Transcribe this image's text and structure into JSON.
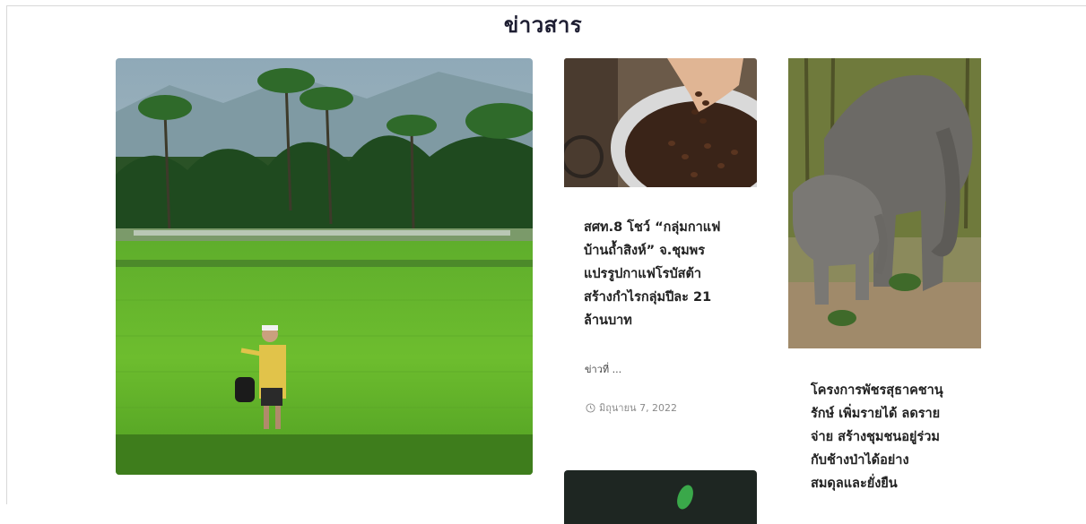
{
  "section": {
    "title": "ข่าวสาร"
  },
  "articles": [
    {
      "title": "สศท.8 โชว์ “กลุ่มกาแฟ\nบ้านถ้ำสิงห์” จ.ชุมพร\nแปรรูปกาแฟโรบัสต้า\nสร้างกำไรกลุ่มปีละ 21\nล้านบาท",
      "excerpt": "ข่าวที่  ...",
      "date": "มิถุนายน 7, 2022",
      "image": "coffee-beans-photo"
    },
    {
      "title": "โครงการพัชรสุธาคชานุ\nรักษ์ เพิ่มรายได้ ลดราย\nจ่าย สร้างชุมชนอยู่ร่วม\nกับช้างป่าได้อย่าง\nสมดุลและยั่งยืน",
      "image": "elephants-photo"
    }
  ],
  "featured": {
    "image": "rice-field-farmer-photo"
  },
  "icons": {
    "date": "clock-icon"
  },
  "colors": {
    "title": "#1e1e32",
    "text": "#222222",
    "muted": "#8a8a8a"
  }
}
